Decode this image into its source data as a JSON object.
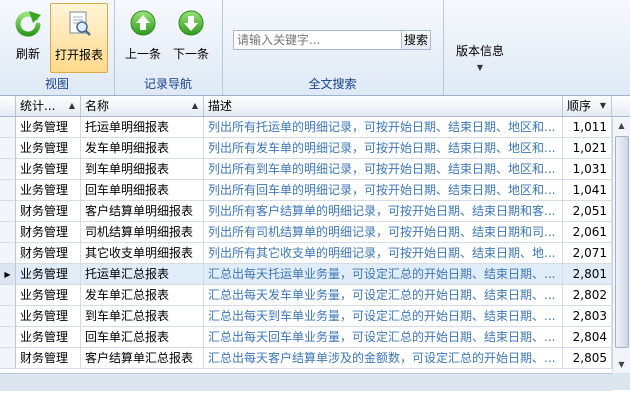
{
  "ribbon": {
    "groups": {
      "view": "视图",
      "nav": "记录导航",
      "search": "全文搜索"
    },
    "buttons": {
      "refresh": "刷新",
      "open_report": "打开报表",
      "prev": "上一条",
      "next": "下一条",
      "version": "版本信息"
    },
    "search": {
      "placeholder": "请输入关键字...",
      "button": "搜索"
    }
  },
  "grid": {
    "columns": [
      "统计...",
      "名称",
      "描述",
      "顺序"
    ],
    "selected_row": 7,
    "rows": [
      {
        "cat": "业务管理",
        "name": "托运单明细报表",
        "desc": "列出所有托运单的明细记录，可按开始日期、结束日期、地区和...",
        "order": "1,011"
      },
      {
        "cat": "业务管理",
        "name": "发车单明细报表",
        "desc": "列出所有发车单的明细记录，可按开始日期、结束日期、地区和...",
        "order": "1,021"
      },
      {
        "cat": "业务管理",
        "name": "到车单明细报表",
        "desc": "列出所有到车单的明细记录，可按开始日期、结束日期、地区和...",
        "order": "1,031"
      },
      {
        "cat": "业务管理",
        "name": "回车单明细报表",
        "desc": "列出所有回车单的明细记录，可按开始日期、结束日期、地区和...",
        "order": "1,041"
      },
      {
        "cat": "财务管理",
        "name": "客户结算单明细报表",
        "desc": "列出所有客户结算单的明细记录，可按开始日期、结束日期和客...",
        "order": "2,051"
      },
      {
        "cat": "财务管理",
        "name": "司机结算单明细报表",
        "desc": "列出所有司机结算单的明细记录，可按开始日期、结束日期和司...",
        "order": "2,061"
      },
      {
        "cat": "财务管理",
        "name": "其它收支单明细报表",
        "desc": "列出所有其它收支单的明细记录，可按开始日期、结束日期、地...",
        "order": "2,071"
      },
      {
        "cat": "业务管理",
        "name": "托运单汇总报表",
        "desc": "汇总出每天托运单业务量，可设定汇总的开始日期、结束日期、...",
        "order": "2,801"
      },
      {
        "cat": "业务管理",
        "name": "发车单汇总报表",
        "desc": "汇总出每天发车单业务量，可设定汇总的开始日期、结束日期、...",
        "order": "2,802"
      },
      {
        "cat": "业务管理",
        "name": "到车单汇总报表",
        "desc": "汇总出每天到车单业务量，可设定汇总的开始日期、结束日期、...",
        "order": "2,803"
      },
      {
        "cat": "业务管理",
        "name": "回车单汇总报表",
        "desc": "汇总出每天回车单业务量，可设定汇总的开始日期、结束日期、...",
        "order": "2,804"
      },
      {
        "cat": "财务管理",
        "name": "客户结算单汇总报表",
        "desc": "汇总出每天客户结算单涉及的金额数，可设定汇总的开始日期、...",
        "order": "2,805"
      }
    ]
  },
  "colors": {
    "description_text": "#3d77b8",
    "group_label": "#15428b",
    "selected_row": "#e1ecf9"
  },
  "icons": {
    "refresh": "refresh-icon",
    "open_report": "document-search-icon",
    "prev": "arrow-up-icon",
    "next": "arrow-down-icon"
  }
}
